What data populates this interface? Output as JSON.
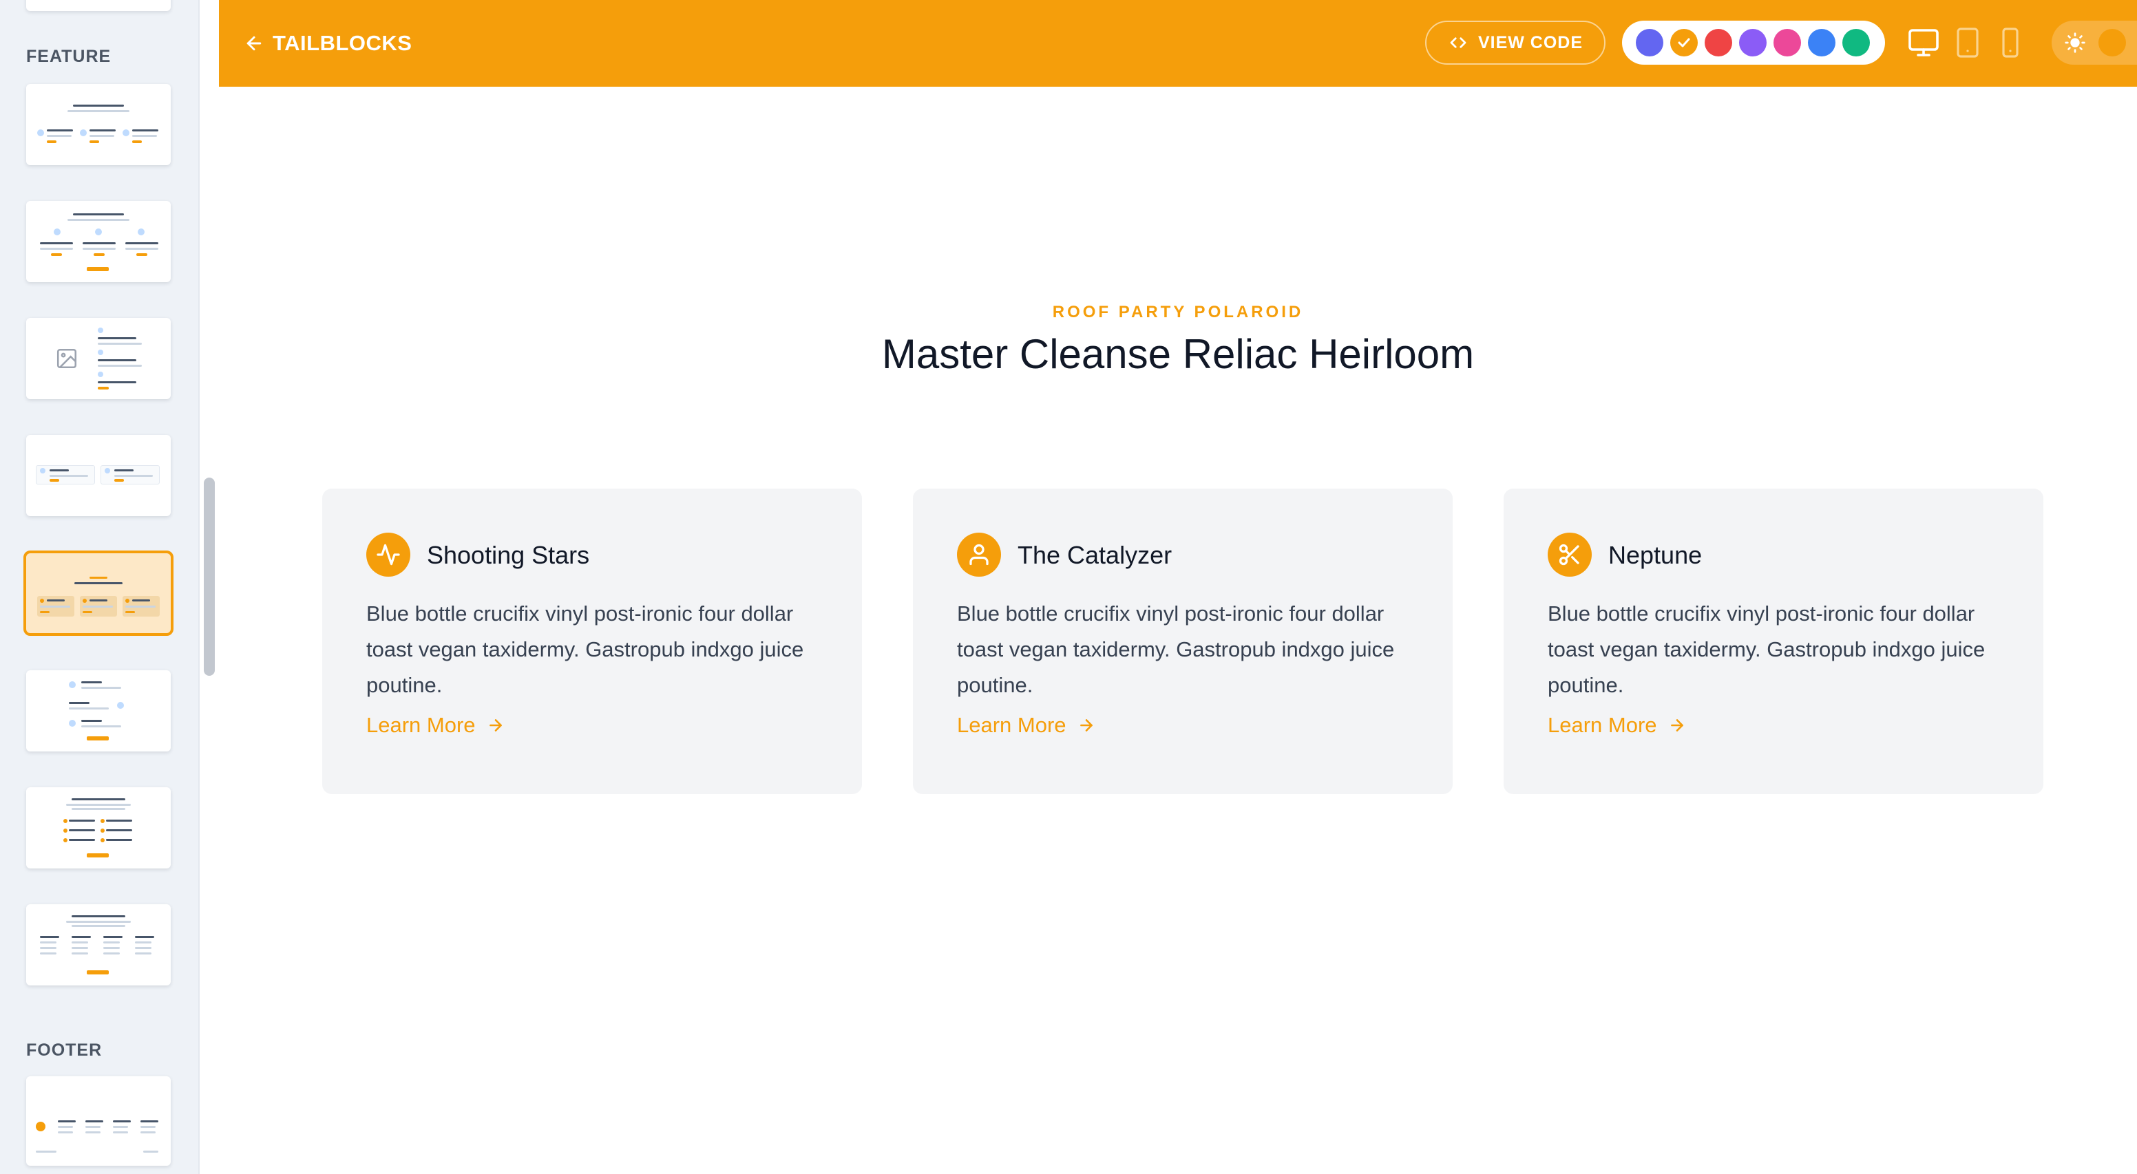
{
  "sidebar": {
    "sections": [
      {
        "label": "FEATURE"
      },
      {
        "label": "FOOTER"
      }
    ]
  },
  "header": {
    "back_label": "TAILBLOCKS",
    "view_code_label": "VIEW CODE",
    "swatches": [
      {
        "name": "indigo",
        "color": "#6366f1",
        "selected": false
      },
      {
        "name": "yellow",
        "color": "#f59e0b",
        "selected": true
      },
      {
        "name": "red",
        "color": "#ef4444",
        "selected": false
      },
      {
        "name": "purple",
        "color": "#8b5cf6",
        "selected": false
      },
      {
        "name": "pink",
        "color": "#ec4899",
        "selected": false
      },
      {
        "name": "blue",
        "color": "#3b82f6",
        "selected": false
      },
      {
        "name": "green",
        "color": "#10b981",
        "selected": false
      }
    ],
    "devices": [
      "desktop-icon",
      "tablet-icon",
      "phone-icon"
    ],
    "theme_icon": "sun-icon"
  },
  "content": {
    "eyebrow": "ROOF PARTY POLAROID",
    "title": "Master Cleanse Reliac Heirloom",
    "cards": [
      {
        "icon": "pulse-icon",
        "title": "Shooting Stars",
        "body": "Blue bottle crucifix vinyl post-ironic four dollar toast vegan taxidermy. Gastropub indxgo juice poutine.",
        "link": "Learn More"
      },
      {
        "icon": "user-icon",
        "title": "The Catalyzer",
        "body": "Blue bottle crucifix vinyl post-ironic four dollar toast vegan taxidermy. Gastropub indxgo juice poutine.",
        "link": "Learn More"
      },
      {
        "icon": "scissors-icon",
        "title": "Neptune",
        "body": "Blue bottle crucifix vinyl post-ironic four dollar toast vegan taxidermy. Gastropub indxgo juice poutine.",
        "link": "Learn More"
      }
    ]
  },
  "colors": {
    "accent": "#f59e0b",
    "sidebar_bg": "#eef2f7",
    "card_bg": "#f3f4f6"
  }
}
